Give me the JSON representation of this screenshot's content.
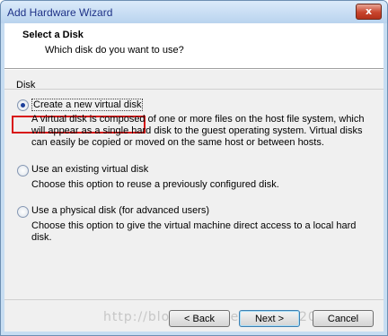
{
  "window": {
    "title": "Add Hardware Wizard",
    "close_glyph": "x"
  },
  "header": {
    "title": "Select a Disk",
    "subtitle": "Which disk do you want to use?"
  },
  "group": {
    "label": "Disk"
  },
  "options": [
    {
      "label": "Create a new virtual disk",
      "checked": true,
      "description": "A virtual disk is composed of one or more files on the host file system, which will appear as a single hard disk to the guest operating system. Virtual disks can easily be copied or moved on the same host or between hosts."
    },
    {
      "label": "Use an existing virtual disk",
      "checked": false,
      "description": "Choose this option to reuse a previously configured disk."
    },
    {
      "label": "Use a physical disk (for advanced users)",
      "checked": false,
      "description": "Choose this option to give the virtual machine direct access to a local hard disk."
    }
  ],
  "buttons": {
    "back": "< Back",
    "next": "Next >",
    "cancel": "Cancel"
  },
  "watermark": "http://blog.csdn.net/wwm@20124"
}
